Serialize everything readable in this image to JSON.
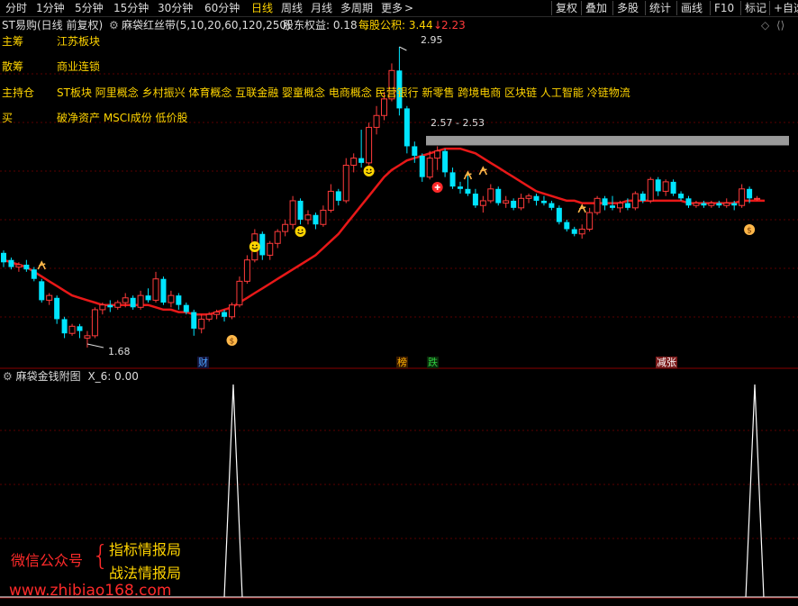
{
  "toolbar": {
    "periods": [
      "分时",
      "1分钟",
      "5分钟",
      "15分钟",
      "30分钟",
      "60分钟",
      "日线",
      "周线",
      "月线",
      "多周期",
      "更多"
    ],
    "active_period": "日线",
    "more_arrow": ">",
    "buttons": [
      "复权",
      "叠加",
      "多股",
      "统计",
      "画线",
      "F10",
      "标记",
      "+自选"
    ]
  },
  "info": {
    "stock_title": "ST易购(日线 前复权)",
    "indicator": "麻袋红丝带(5,10,20,60,120,250)",
    "equity_label": "股东权益: 0.18",
    "fund_label": "每股公积: 3.44",
    "fund_change": "2.23"
  },
  "rows": [
    {
      "label": "主筹",
      "value": "江苏板块"
    },
    {
      "label": "散筹",
      "value": "商业连锁"
    },
    {
      "label": "主持仓",
      "value": "ST板块 阿里概念 乡村振兴 体育概念 互联金融 婴童概念 电商概念 民营银行 新零售 跨境电商 区块链 人工智能 冷链物流"
    },
    {
      "label": "买",
      "value": "破净资产 MSCI成份 低价股"
    }
  ],
  "price_labels": {
    "high": "2.95",
    "low": "1.68",
    "range": "2.57 - 2.53"
  },
  "events": [
    {
      "text": "财",
      "color": "#4aa3ff",
      "bg": "#1a1a3a"
    },
    {
      "text": "榜",
      "color": "#ffb300",
      "bg": "#3a1a00"
    },
    {
      "text": "跌",
      "color": "#2ecc40",
      "bg": "#0a2a0a"
    },
    {
      "text": "减张",
      "color": "#ffffff",
      "bg": "#7a1a1a"
    }
  ],
  "sub_chart": {
    "title": "麻袋金钱附图",
    "value_label": "X_6: 0.00"
  },
  "watermark": {
    "account_label": "微信公众号",
    "brace": "{",
    "name1": "指标情报局",
    "name2": "战法情报局",
    "url": "www.zhibiao168.com"
  },
  "colors": {
    "up": "#ff3b3b",
    "down": "#00e5ff",
    "ribbon": "#e81818",
    "active_tab": "#ffd400",
    "label_yellow": "#ffd400",
    "grid": "#5a0000"
  },
  "chart_data": {
    "type": "candlestick",
    "high": 2.95,
    "low": 1.68,
    "range_band": [
      2.53,
      2.57
    ],
    "candles": [
      {
        "o": 2.08,
        "c": 2.04,
        "h": 2.09,
        "l": 2.02
      },
      {
        "o": 2.05,
        "c": 2.02,
        "h": 2.06,
        "l": 2.01
      },
      {
        "o": 2.02,
        "c": 2.03,
        "h": 2.04,
        "l": 2.0
      },
      {
        "o": 2.03,
        "c": 2.01,
        "h": 2.05,
        "l": 2.0
      },
      {
        "o": 2.01,
        "c": 1.97,
        "h": 2.02,
        "l": 1.96
      },
      {
        "o": 1.96,
        "c": 1.88,
        "h": 1.97,
        "l": 1.87
      },
      {
        "o": 1.88,
        "c": 1.9,
        "h": 1.91,
        "l": 1.86
      },
      {
        "o": 1.89,
        "c": 1.8,
        "h": 1.9,
        "l": 1.78
      },
      {
        "o": 1.8,
        "c": 1.74,
        "h": 1.81,
        "l": 1.72
      },
      {
        "o": 1.74,
        "c": 1.77,
        "h": 1.78,
        "l": 1.73
      },
      {
        "o": 1.77,
        "c": 1.75,
        "h": 1.78,
        "l": 1.72
      },
      {
        "o": 1.72,
        "c": 1.73,
        "h": 1.75,
        "l": 1.68
      },
      {
        "o": 1.73,
        "c": 1.84,
        "h": 1.85,
        "l": 1.72
      },
      {
        "o": 1.84,
        "c": 1.86,
        "h": 1.87,
        "l": 1.82
      },
      {
        "o": 1.86,
        "c": 1.85,
        "h": 1.88,
        "l": 1.83
      },
      {
        "o": 1.85,
        "c": 1.87,
        "h": 1.88,
        "l": 1.84
      },
      {
        "o": 1.87,
        "c": 1.89,
        "h": 1.91,
        "l": 1.85
      },
      {
        "o": 1.89,
        "c": 1.85,
        "h": 1.9,
        "l": 1.84
      },
      {
        "o": 1.85,
        "c": 1.9,
        "h": 1.92,
        "l": 1.84
      },
      {
        "o": 1.9,
        "c": 1.88,
        "h": 1.93,
        "l": 1.87
      },
      {
        "o": 1.88,
        "c": 1.97,
        "h": 2.0,
        "l": 1.87
      },
      {
        "o": 1.97,
        "c": 1.87,
        "h": 1.98,
        "l": 1.86
      },
      {
        "o": 1.87,
        "c": 1.9,
        "h": 1.92,
        "l": 1.85
      },
      {
        "o": 1.9,
        "c": 1.86,
        "h": 1.91,
        "l": 1.84
      },
      {
        "o": 1.86,
        "c": 1.83,
        "h": 1.87,
        "l": 1.82
      },
      {
        "o": 1.83,
        "c": 1.76,
        "h": 1.84,
        "l": 1.73
      },
      {
        "o": 1.76,
        "c": 1.8,
        "h": 1.82,
        "l": 1.74
      },
      {
        "o": 1.8,
        "c": 1.82,
        "h": 1.83,
        "l": 1.79
      },
      {
        "o": 1.82,
        "c": 1.83,
        "h": 1.84,
        "l": 1.8
      },
      {
        "o": 1.83,
        "c": 1.81,
        "h": 1.84,
        "l": 1.79
      },
      {
        "o": 1.81,
        "c": 1.86,
        "h": 1.87,
        "l": 1.8
      },
      {
        "o": 1.86,
        "c": 1.96,
        "h": 1.98,
        "l": 1.85
      },
      {
        "o": 1.96,
        "c": 2.05,
        "h": 2.07,
        "l": 1.95
      },
      {
        "o": 2.05,
        "c": 2.16,
        "h": 2.18,
        "l": 2.04
      },
      {
        "o": 2.16,
        "c": 2.07,
        "h": 2.17,
        "l": 2.05
      },
      {
        "o": 2.07,
        "c": 2.12,
        "h": 2.13,
        "l": 2.05
      },
      {
        "o": 2.12,
        "c": 2.17,
        "h": 2.18,
        "l": 2.1
      },
      {
        "o": 2.17,
        "c": 2.2,
        "h": 2.22,
        "l": 2.15
      },
      {
        "o": 2.2,
        "c": 2.3,
        "h": 2.32,
        "l": 2.18
      },
      {
        "o": 2.3,
        "c": 2.22,
        "h": 2.31,
        "l": 2.2
      },
      {
        "o": 2.22,
        "c": 2.24,
        "h": 2.26,
        "l": 2.2
      },
      {
        "o": 2.24,
        "c": 2.2,
        "h": 2.25,
        "l": 2.18
      },
      {
        "o": 2.2,
        "c": 2.26,
        "h": 2.28,
        "l": 2.19
      },
      {
        "o": 2.26,
        "c": 2.34,
        "h": 2.37,
        "l": 2.25
      },
      {
        "o": 2.34,
        "c": 2.3,
        "h": 2.35,
        "l": 2.28
      },
      {
        "o": 2.3,
        "c": 2.45,
        "h": 2.48,
        "l": 2.29
      },
      {
        "o": 2.45,
        "c": 2.48,
        "h": 2.5,
        "l": 2.42
      },
      {
        "o": 2.48,
        "c": 2.46,
        "h": 2.6,
        "l": 2.44
      },
      {
        "o": 2.46,
        "c": 2.61,
        "h": 2.63,
        "l": 2.45
      },
      {
        "o": 2.61,
        "c": 2.66,
        "h": 2.7,
        "l": 2.58
      },
      {
        "o": 2.66,
        "c": 2.73,
        "h": 2.76,
        "l": 2.64
      },
      {
        "o": 2.73,
        "c": 2.85,
        "h": 2.88,
        "l": 2.72
      },
      {
        "o": 2.85,
        "c": 2.69,
        "h": 2.95,
        "l": 2.66
      },
      {
        "o": 2.69,
        "c": 2.53,
        "h": 2.7,
        "l": 2.5
      },
      {
        "o": 2.53,
        "c": 2.49,
        "h": 2.55,
        "l": 2.46
      },
      {
        "o": 2.49,
        "c": 2.4,
        "h": 2.5,
        "l": 2.38
      },
      {
        "o": 2.4,
        "c": 2.48,
        "h": 2.51,
        "l": 2.39
      },
      {
        "o": 2.48,
        "c": 2.51,
        "h": 2.53,
        "l": 2.43
      },
      {
        "o": 2.51,
        "c": 2.42,
        "h": 2.52,
        "l": 2.4
      },
      {
        "o": 2.42,
        "c": 2.36,
        "h": 2.44,
        "l": 2.35
      },
      {
        "o": 2.36,
        "c": 2.35,
        "h": 2.38,
        "l": 2.33
      },
      {
        "o": 2.35,
        "c": 2.33,
        "h": 2.41,
        "l": 2.32
      },
      {
        "o": 2.33,
        "c": 2.28,
        "h": 2.35,
        "l": 2.27
      },
      {
        "o": 2.28,
        "c": 2.3,
        "h": 2.32,
        "l": 2.25
      },
      {
        "o": 2.3,
        "c": 2.35,
        "h": 2.37,
        "l": 2.29
      },
      {
        "o": 2.35,
        "c": 2.29,
        "h": 2.36,
        "l": 2.28
      },
      {
        "o": 2.29,
        "c": 2.3,
        "h": 2.32,
        "l": 2.27
      },
      {
        "o": 2.3,
        "c": 2.27,
        "h": 2.31,
        "l": 2.26
      },
      {
        "o": 2.27,
        "c": 2.31,
        "h": 2.33,
        "l": 2.26
      },
      {
        "o": 2.31,
        "c": 2.32,
        "h": 2.33,
        "l": 2.29
      },
      {
        "o": 2.32,
        "c": 2.3,
        "h": 2.33,
        "l": 2.28
      },
      {
        "o": 2.3,
        "c": 2.29,
        "h": 2.32,
        "l": 2.28
      },
      {
        "o": 2.29,
        "c": 2.27,
        "h": 2.3,
        "l": 2.26
      },
      {
        "o": 2.27,
        "c": 2.21,
        "h": 2.28,
        "l": 2.2
      },
      {
        "o": 2.21,
        "c": 2.18,
        "h": 2.22,
        "l": 2.17
      },
      {
        "o": 2.18,
        "c": 2.16,
        "h": 2.19,
        "l": 2.15
      },
      {
        "o": 2.16,
        "c": 2.18,
        "h": 2.2,
        "l": 2.14
      },
      {
        "o": 2.18,
        "c": 2.25,
        "h": 2.27,
        "l": 2.17
      },
      {
        "o": 2.25,
        "c": 2.31,
        "h": 2.32,
        "l": 2.24
      },
      {
        "o": 2.31,
        "c": 2.28,
        "h": 2.32,
        "l": 2.26
      },
      {
        "o": 2.28,
        "c": 2.27,
        "h": 2.32,
        "l": 2.26
      },
      {
        "o": 2.27,
        "c": 2.29,
        "h": 2.3,
        "l": 2.25
      },
      {
        "o": 2.29,
        "c": 2.27,
        "h": 2.31,
        "l": 2.26
      },
      {
        "o": 2.27,
        "c": 2.33,
        "h": 2.34,
        "l": 2.26
      },
      {
        "o": 2.33,
        "c": 2.3,
        "h": 2.34,
        "l": 2.29
      },
      {
        "o": 2.3,
        "c": 2.39,
        "h": 2.4,
        "l": 2.29
      },
      {
        "o": 2.39,
        "c": 2.34,
        "h": 2.4,
        "l": 2.32
      },
      {
        "o": 2.34,
        "c": 2.38,
        "h": 2.39,
        "l": 2.32
      },
      {
        "o": 2.38,
        "c": 2.33,
        "h": 2.39,
        "l": 2.32
      },
      {
        "o": 2.33,
        "c": 2.31,
        "h": 2.34,
        "l": 2.3
      },
      {
        "o": 2.31,
        "c": 2.28,
        "h": 2.32,
        "l": 2.27
      },
      {
        "o": 2.28,
        "c": 2.29,
        "h": 2.3,
        "l": 2.27
      },
      {
        "o": 2.29,
        "c": 2.28,
        "h": 2.3,
        "l": 2.27
      },
      {
        "o": 2.28,
        "c": 2.29,
        "h": 2.3,
        "l": 2.27
      },
      {
        "o": 2.29,
        "c": 2.28,
        "h": 2.3,
        "l": 2.27
      },
      {
        "o": 2.28,
        "c": 2.29,
        "h": 2.31,
        "l": 2.27
      },
      {
        "o": 2.29,
        "c": 2.28,
        "h": 2.3,
        "l": 2.26
      },
      {
        "o": 2.28,
        "c": 2.35,
        "h": 2.37,
        "l": 2.27
      },
      {
        "o": 2.35,
        "c": 2.31,
        "h": 2.36,
        "l": 2.29
      },
      {
        "o": 2.31,
        "c": 2.31,
        "h": 2.32,
        "l": 2.3
      }
    ],
    "ribbon": [
      2.05,
      2.04,
      2.03,
      2.02,
      2.0,
      1.98,
      1.96,
      1.94,
      1.92,
      1.9,
      1.89,
      1.88,
      1.87,
      1.86,
      1.86,
      1.86,
      1.86,
      1.86,
      1.86,
      1.86,
      1.85,
      1.84,
      1.84,
      1.83,
      1.83,
      1.82,
      1.82,
      1.82,
      1.83,
      1.84,
      1.85,
      1.87,
      1.89,
      1.91,
      1.93,
      1.95,
      1.97,
      1.99,
      2.01,
      2.03,
      2.05,
      2.07,
      2.1,
      2.13,
      2.16,
      2.2,
      2.24,
      2.28,
      2.32,
      2.36,
      2.4,
      2.43,
      2.45,
      2.47,
      2.48,
      2.49,
      2.5,
      2.51,
      2.52,
      2.52,
      2.52,
      2.51,
      2.5,
      2.48,
      2.46,
      2.44,
      2.42,
      2.4,
      2.38,
      2.36,
      2.34,
      2.33,
      2.32,
      2.31,
      2.3,
      2.3,
      2.29,
      2.29,
      2.29,
      2.29,
      2.29,
      2.29,
      2.3,
      2.3,
      2.3,
      2.3,
      2.3,
      2.3,
      2.3,
      2.3,
      2.29,
      2.29,
      2.29,
      2.29,
      2.29,
      2.29,
      2.29,
      2.3,
      2.3,
      2.3,
      2.3
    ],
    "sub_values_peak_at": [
      0.3,
      0.95
    ]
  }
}
